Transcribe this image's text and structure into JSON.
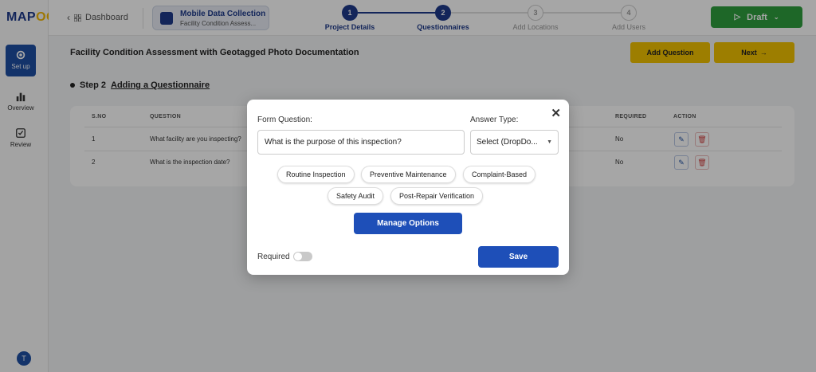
{
  "brand": {
    "logo_main": "MAP",
    "logo_accent": "OG",
    "color_primary": "#1e3a8a",
    "color_accent": "#f2b705"
  },
  "sidebar": {
    "items": [
      {
        "label": "Set up",
        "icon": "gear-icon",
        "active": true
      },
      {
        "label": "Overview",
        "icon": "bar-chart-icon",
        "active": false
      },
      {
        "label": "Review",
        "icon": "checkbox-icon",
        "active": false
      }
    ],
    "avatar_initial": "T"
  },
  "topbar": {
    "back_label": "Dashboard",
    "project_name": "Mobile Data Collection",
    "project_subtitle": "Facility Condition Assess...",
    "steps": [
      {
        "number": "1",
        "label": "Project Details",
        "done": true
      },
      {
        "number": "2",
        "label": "Questionnaires",
        "done": true
      },
      {
        "number": "3",
        "label": "Add Locations",
        "done": false
      },
      {
        "number": "4",
        "label": "Add Users",
        "done": false
      }
    ],
    "draft_label": "Draft"
  },
  "page": {
    "title": "Facility Condition Assessment with Geotagged Photo Documentation",
    "add_question_label": "Add Question",
    "next_label": "Next",
    "step_prefix": "Step 2",
    "step_title": "Adding a Questionnaire"
  },
  "table": {
    "headers": {
      "sno": "S.NO",
      "question": "QUESTION",
      "required": "REQUIRED",
      "action": "ACTION"
    },
    "rows": [
      {
        "sno": "1",
        "question": "What facility are you inspecting?",
        "required": "No"
      },
      {
        "sno": "2",
        "question": "What is the inspection date?",
        "required": "No"
      }
    ]
  },
  "modal": {
    "question_label": "Form Question:",
    "question_value": "What is the purpose of this inspection?",
    "answer_type_label": "Answer Type:",
    "answer_type_value": "Select (DropDo...",
    "options": [
      "Routine Inspection",
      "Preventive Maintenance",
      "Complaint-Based",
      "Safety Audit",
      "Post-Repair Verification"
    ],
    "manage_options_label": "Manage Options",
    "required_label": "Required",
    "required_on": false,
    "save_label": "Save"
  }
}
